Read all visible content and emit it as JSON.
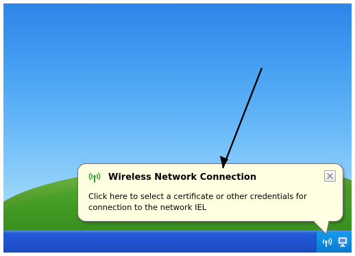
{
  "balloon": {
    "title": "Wireless Network Connection",
    "message": "Click here to select a certificate or other credentials for\nconnection to the network IEL"
  },
  "tray": {
    "icons": [
      "wireless-network-icon",
      "monitor-icon"
    ]
  },
  "colors": {
    "balloon_background": "#ffffe1",
    "taskbar_blue": "#1f52cf",
    "tray_blue": "#0f8ddf",
    "sky_blue": "#5cb0f6",
    "grass_green": "#4ea82d"
  }
}
